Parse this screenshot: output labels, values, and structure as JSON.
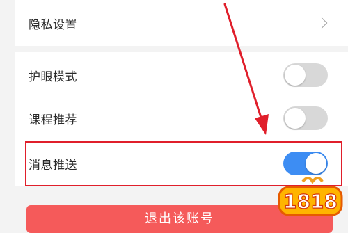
{
  "settings": {
    "privacy": {
      "label": "隐私设置"
    },
    "eye_protection": {
      "label": "护眼模式",
      "state": "off"
    },
    "course_recommend": {
      "label": "课程推荐",
      "state": "off"
    },
    "message_push": {
      "label": "消息推送",
      "state": "on"
    }
  },
  "logout": {
    "label": "退出该账号"
  },
  "watermark": {
    "text": "1818"
  },
  "colors": {
    "toggle_on": "#3d8df3",
    "toggle_off": "#d8d8d8",
    "highlight": "#e01f2b",
    "logout_bg": "#f55a5a"
  },
  "icons": {
    "privacy_chevron": "chevron-right-icon",
    "annotation": "red-arrow-icon"
  }
}
